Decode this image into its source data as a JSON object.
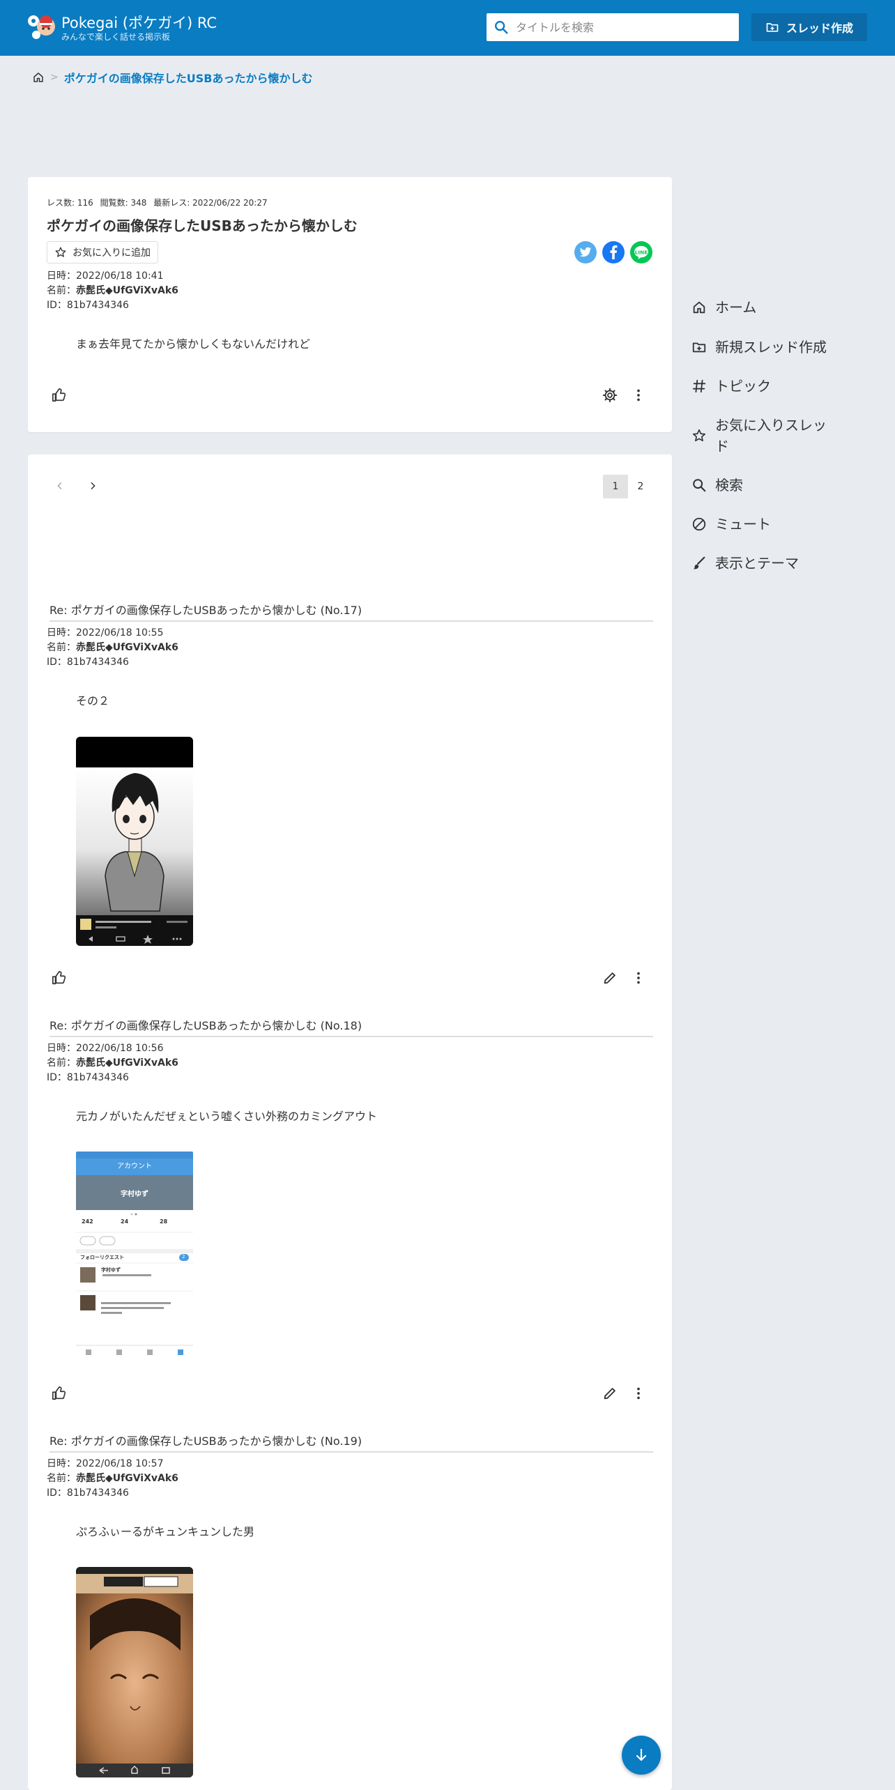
{
  "header": {
    "site_title": "Pokegai (ポケガイ) RC",
    "site_subtitle": "みんなで楽しく話せる掲示板",
    "search_placeholder": "タイトルを検索",
    "new_thread_label": "スレッド作成"
  },
  "breadcrumb": {
    "current": "ポケガイの画像保存したUSBあったから懐かしむ"
  },
  "thread": {
    "res_count": "レス数: 116",
    "view_count": "閲覧数: 348",
    "last_res": "最新レス: 2022/06/22 20:27",
    "title": "ポケガイの画像保存したUSBあったから懐かしむ",
    "favorite_label": "お気に入りに追加",
    "date": "日時：2022/06/18 10:41",
    "name_prefix": "名前：",
    "name": "赤髭氏◆UfGViXvAk6",
    "id": "ID：81b7434346",
    "body": "まぁ去年見てたから懐かしくもないんだけれど"
  },
  "pager": {
    "pages": [
      "1",
      "2"
    ],
    "current": "1"
  },
  "posts": [
    {
      "heading": "Re: ポケガイの画像保存したUSBあったから懐かしむ (No.17)",
      "date": "日時：2022/06/18 10:55",
      "name_prefix": "名前：",
      "name": "赤髭氏◆UfGViXvAk6",
      "id": "ID：81b7434346",
      "body": "その２"
    },
    {
      "heading": "Re: ポケガイの画像保存したUSBあったから懐かしむ (No.18)",
      "date": "日時：2022/06/18 10:56",
      "name_prefix": "名前：",
      "name": "赤髭氏◆UfGViXvAk6",
      "id": "ID：81b7434346",
      "body": "元カノがいたんだぜぇという嘘くさい外務のカミングアウト",
      "image_texts": {
        "account_header": "アカウント",
        "user_name": "字村ゆず",
        "stat_1": "242",
        "stat_2": "24",
        "stat_3": "28",
        "follow_request": "フォローリクエスト",
        "follow_count": "2"
      }
    },
    {
      "heading": "Re: ポケガイの画像保存したUSBあったから懐かしむ (No.19)",
      "date": "日時：2022/06/18 10:57",
      "name_prefix": "名前：",
      "name": "赤髭氏◆UfGViXvAk6",
      "id": "ID：81b7434346",
      "body": "ぷろふぃーるがキュンキュンした男"
    }
  ],
  "sidebar": {
    "items": [
      {
        "label": "ホーム",
        "icon": "home-icon"
      },
      {
        "label": "新規スレッド作成",
        "icon": "folder-plus-icon"
      },
      {
        "label": "トピック",
        "icon": "hash-icon"
      },
      {
        "label": "お気に入りスレッド",
        "icon": "star-icon"
      },
      {
        "label": "検索",
        "icon": "search-icon"
      },
      {
        "label": "ミュート",
        "icon": "block-icon"
      },
      {
        "label": "表示とテーマ",
        "icon": "brush-icon"
      }
    ]
  },
  "colors": {
    "header_bg": "#0a7cc2",
    "accent": "#0a7cc2",
    "page_bg": "#e8ecf1"
  }
}
